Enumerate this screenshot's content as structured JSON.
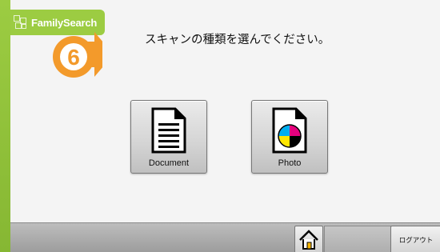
{
  "logo": {
    "text": "FamilySearch"
  },
  "step": {
    "number": "6"
  },
  "prompt": {
    "text": "スキャンの種類を選んでください。"
  },
  "buttons": {
    "document_label": "Document",
    "photo_label": "Photo"
  },
  "bottom_bar": {
    "logout_label": "ログアウト"
  },
  "icons": {
    "document": "document-icon",
    "photo": "photo-icon",
    "home": "home-icon",
    "step_arrow": "arrow-right-icon"
  },
  "colors": {
    "brand_green": "#8fc43a",
    "badge_orange": "#f39a2b",
    "cyan": "#00aeef",
    "magenta": "#e6007e",
    "yellow": "#ffe600"
  }
}
